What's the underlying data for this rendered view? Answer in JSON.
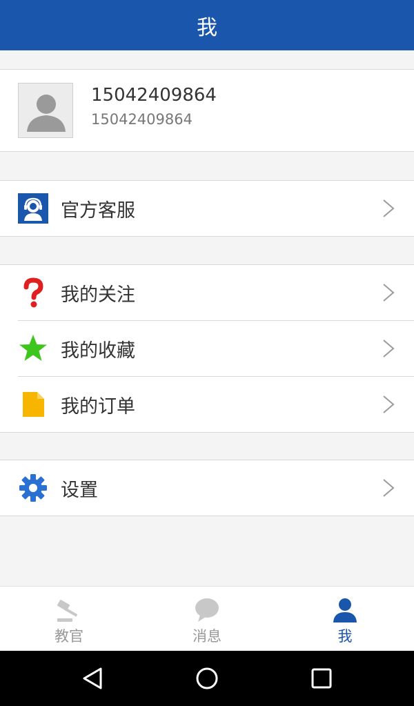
{
  "header": {
    "title": "我"
  },
  "profile": {
    "name": "15042409864",
    "phone": "15042409864",
    "avatar_icon": "default-avatar-icon"
  },
  "service": {
    "label": "官方客服",
    "icon": "customer-service-icon",
    "icon_bg": "#1a56ac"
  },
  "menu": [
    {
      "label": "我的关注",
      "icon": "question-mark-icon",
      "color": "#e02020"
    },
    {
      "label": "我的收藏",
      "icon": "star-icon",
      "color": "#3ec61f"
    },
    {
      "label": "我的订单",
      "icon": "document-icon",
      "color": "#f7b500"
    }
  ],
  "settings": {
    "label": "设置",
    "icon": "gear-icon",
    "color": "#2a6fd4"
  },
  "tabs": [
    {
      "label": "教官",
      "icon": "gavel-icon",
      "active": false
    },
    {
      "label": "消息",
      "icon": "chat-bubble-icon",
      "active": false
    },
    {
      "label": "我",
      "icon": "person-icon",
      "active": true
    }
  ],
  "colors": {
    "primary": "#1a56ac",
    "inactive": "#999999"
  },
  "system_nav": {
    "icons": [
      "back-icon",
      "home-icon",
      "recents-icon"
    ]
  }
}
